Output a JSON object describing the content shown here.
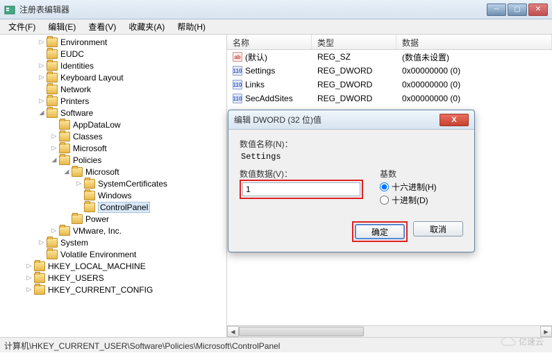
{
  "window": {
    "title": "注册表编辑器",
    "min": "─",
    "max": "▢",
    "close": "✕"
  },
  "menu": [
    "文件(F)",
    "编辑(E)",
    "查看(V)",
    "收藏夹(A)",
    "帮助(H)"
  ],
  "tree": [
    {
      "depth": 2,
      "exp": "▷",
      "label": "Environment"
    },
    {
      "depth": 2,
      "exp": "",
      "label": "EUDC"
    },
    {
      "depth": 2,
      "exp": "▷",
      "label": "Identities"
    },
    {
      "depth": 2,
      "exp": "▷",
      "label": "Keyboard Layout"
    },
    {
      "depth": 2,
      "exp": "",
      "label": "Network"
    },
    {
      "depth": 2,
      "exp": "▷",
      "label": "Printers"
    },
    {
      "depth": 2,
      "exp": "◢",
      "label": "Software"
    },
    {
      "depth": 3,
      "exp": "",
      "label": "AppDataLow"
    },
    {
      "depth": 3,
      "exp": "▷",
      "label": "Classes"
    },
    {
      "depth": 3,
      "exp": "▷",
      "label": "Microsoft"
    },
    {
      "depth": 3,
      "exp": "◢",
      "label": "Policies"
    },
    {
      "depth": 4,
      "exp": "◢",
      "label": "Microsoft"
    },
    {
      "depth": 5,
      "exp": "▷",
      "label": "SystemCertificates"
    },
    {
      "depth": 5,
      "exp": "",
      "label": "Windows"
    },
    {
      "depth": 5,
      "exp": "",
      "label": "ControlPanel",
      "selected": true
    },
    {
      "depth": 4,
      "exp": "",
      "label": "Power"
    },
    {
      "depth": 3,
      "exp": "▷",
      "label": "VMware, Inc."
    },
    {
      "depth": 2,
      "exp": "▷",
      "label": "System"
    },
    {
      "depth": 2,
      "exp": "",
      "label": "Volatile Environment"
    },
    {
      "depth": 1,
      "exp": "▷",
      "label": "HKEY_LOCAL_MACHINE"
    },
    {
      "depth": 1,
      "exp": "▷",
      "label": "HKEY_USERS"
    },
    {
      "depth": 1,
      "exp": "▷",
      "label": "HKEY_CURRENT_CONFIG"
    }
  ],
  "columns": {
    "name": "名称",
    "type": "类型",
    "data": "数据"
  },
  "values": [
    {
      "icon": "sz",
      "glyph": "ab",
      "name": "(默认)",
      "type": "REG_SZ",
      "data": "(数值未设置)"
    },
    {
      "icon": "dw",
      "glyph": "110",
      "name": "Settings",
      "type": "REG_DWORD",
      "data": "0x00000000 (0)"
    },
    {
      "icon": "dw",
      "glyph": "110",
      "name": "Links",
      "type": "REG_DWORD",
      "data": "0x00000000 (0)"
    },
    {
      "icon": "dw",
      "glyph": "110",
      "name": "SecAddSites",
      "type": "REG_DWORD",
      "data": "0x00000000 (0)"
    }
  ],
  "dialog": {
    "title": "编辑 DWORD (32 位)值",
    "close": "X",
    "name_label": "数值名称(N)：",
    "name_value": "Settings",
    "data_label": "数值数据(V)：",
    "data_value": "1",
    "base_label": "基数",
    "radio_hex": "十六进制(H)",
    "radio_dec": "十进制(D)",
    "ok": "确定",
    "cancel": "取消"
  },
  "statusbar": "计算机\\HKEY_CURRENT_USER\\Software\\Policies\\Microsoft\\ControlPanel",
  "watermark": "亿速云"
}
